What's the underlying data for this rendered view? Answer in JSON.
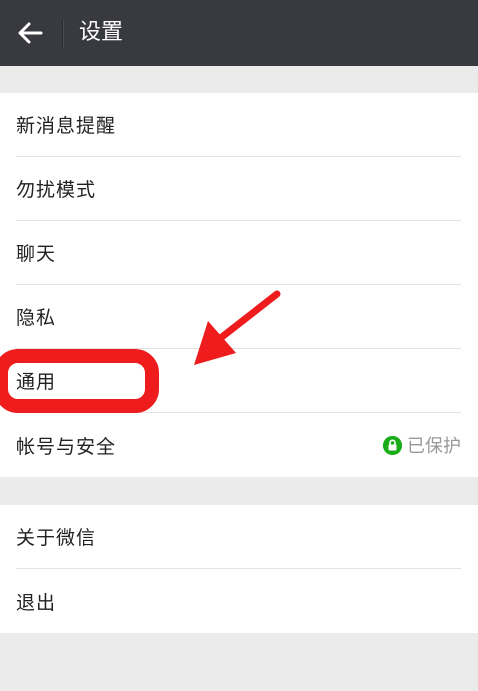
{
  "header": {
    "back_icon": "arrow-left-icon",
    "title": "设置"
  },
  "settings_group_1": [
    {
      "label": "新消息提醒"
    },
    {
      "label": "勿扰模式"
    },
    {
      "label": "聊天"
    },
    {
      "label": "隐私"
    },
    {
      "label": "通用"
    },
    {
      "label": "帐号与安全",
      "status": "已保护",
      "status_icon": "lock-icon",
      "status_color": "#1aad19"
    }
  ],
  "settings_group_2": [
    {
      "label": "关于微信"
    },
    {
      "label": "退出"
    }
  ],
  "annotation": {
    "color": "#ee1c1c"
  }
}
